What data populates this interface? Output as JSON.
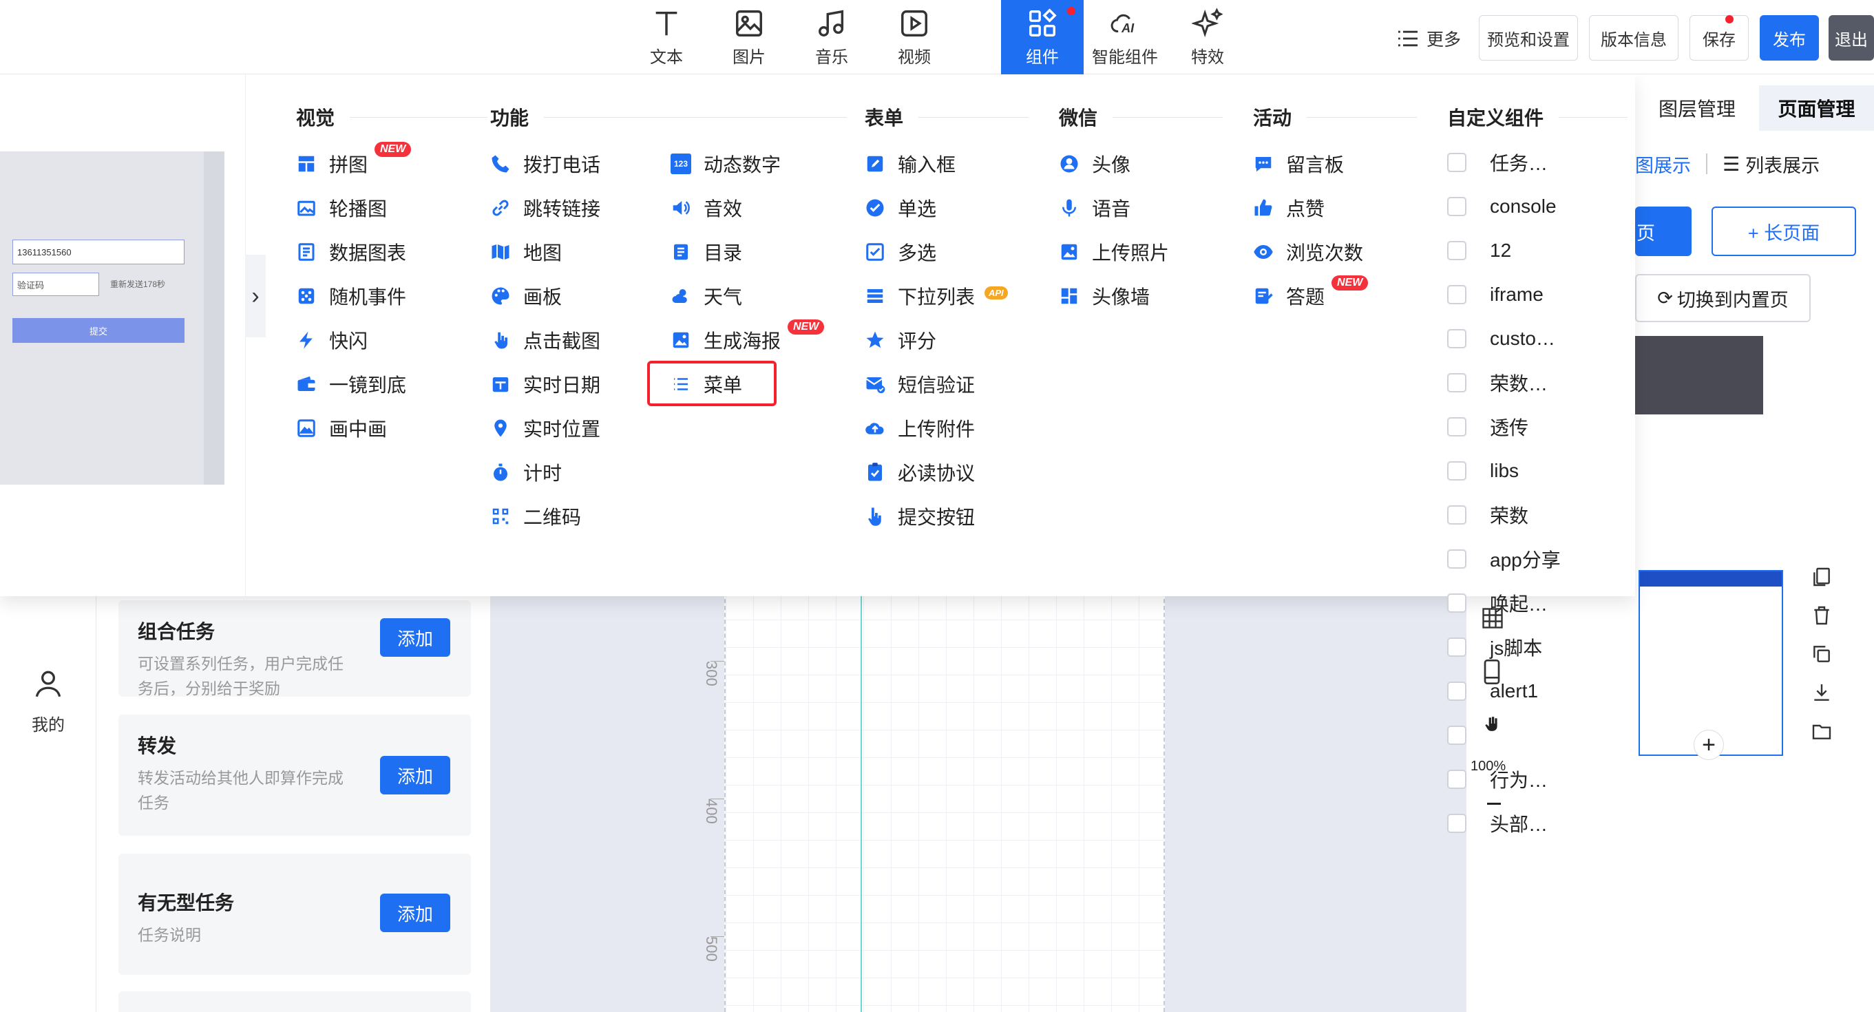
{
  "topbar": {
    "tools": [
      {
        "label": "文本",
        "icon": "text-icon"
      },
      {
        "label": "图片",
        "icon": "image-icon"
      },
      {
        "label": "音乐",
        "icon": "music-icon"
      },
      {
        "label": "视频",
        "icon": "video-icon"
      },
      {
        "label": "组件",
        "icon": "components-icon",
        "active": true
      },
      {
        "label": "智能组件",
        "icon": "ai-cloud-icon"
      },
      {
        "label": "特效",
        "icon": "sparkle-icon"
      }
    ],
    "more": "更多",
    "preview_settings": "预览和设置",
    "version_info": "版本信息",
    "save": "保存",
    "publish": "发布",
    "exit": "退出"
  },
  "preview": {
    "phone_value": "13611351560",
    "code_placeholder": "验证码",
    "resend": "重新发送178秒",
    "submit": "提交"
  },
  "columns": {
    "visual": {
      "title": "视觉",
      "items": [
        {
          "label": "拼图",
          "icon": "puzzle-icon",
          "badge": "NEW"
        },
        {
          "label": "轮播图",
          "icon": "carousel-icon"
        },
        {
          "label": "数据图表",
          "icon": "chart-icon"
        },
        {
          "label": "随机事件",
          "icon": "dice-icon"
        },
        {
          "label": "快闪",
          "icon": "lightning-icon"
        },
        {
          "label": "一镜到底",
          "icon": "wallet-icon"
        },
        {
          "label": "画中画",
          "icon": "picture-in-picture-icon"
        }
      ]
    },
    "function": {
      "title": "功能",
      "items_a": [
        {
          "label": "拨打电话",
          "icon": "phone-icon"
        },
        {
          "label": "跳转链接",
          "icon": "link-icon"
        },
        {
          "label": "地图",
          "icon": "map-icon"
        },
        {
          "label": "画板",
          "icon": "palette-icon"
        },
        {
          "label": "点击截图",
          "icon": "tap-icon"
        },
        {
          "label": "实时日期",
          "icon": "calendar-icon"
        },
        {
          "label": "实时位置",
          "icon": "location-icon"
        },
        {
          "label": "计时",
          "icon": "stopwatch-icon"
        },
        {
          "label": "二维码",
          "icon": "qrcode-icon"
        }
      ],
      "items_b": [
        {
          "label": "动态数字",
          "icon": "number-icon",
          "icon_text": "123"
        },
        {
          "label": "音效",
          "icon": "speaker-icon"
        },
        {
          "label": "目录",
          "icon": "catalog-icon"
        },
        {
          "label": "天气",
          "icon": "weather-icon"
        },
        {
          "label": "生成海报",
          "icon": "poster-icon",
          "badge": "NEW"
        },
        {
          "label": "菜单",
          "icon": "menu-list-icon"
        }
      ]
    },
    "form": {
      "title": "表单",
      "items": [
        {
          "label": "输入框",
          "icon": "edit-icon"
        },
        {
          "label": "单选",
          "icon": "radio-check-icon"
        },
        {
          "label": "多选",
          "icon": "checkbox-icon"
        },
        {
          "label": "下拉列表",
          "icon": "dropdown-list-icon",
          "badge": "API"
        },
        {
          "label": "评分",
          "icon": "star-icon"
        },
        {
          "label": "短信验证",
          "icon": "sms-icon"
        },
        {
          "label": "上传附件",
          "icon": "upload-cloud-icon"
        },
        {
          "label": "必读协议",
          "icon": "agreement-icon"
        },
        {
          "label": "提交按钮",
          "icon": "pointer-icon"
        }
      ]
    },
    "wechat": {
      "title": "微信",
      "items": [
        {
          "label": "头像",
          "icon": "user-circle-icon"
        },
        {
          "label": "语音",
          "icon": "microphone-icon"
        },
        {
          "label": "上传照片",
          "icon": "photo-icon"
        },
        {
          "label": "头像墙",
          "icon": "grid-icon"
        }
      ]
    },
    "activity": {
      "title": "活动",
      "items": [
        {
          "label": "留言板",
          "icon": "message-icon"
        },
        {
          "label": "点赞",
          "icon": "thumb-up-icon"
        },
        {
          "label": "浏览次数",
          "icon": "eye-icon"
        },
        {
          "label": "答题",
          "icon": "quiz-icon",
          "badge": "NEW"
        }
      ]
    },
    "custom": {
      "title": "自定义组件",
      "items": [
        "任务…",
        "console",
        "12",
        "iframe",
        "custo…",
        "荣数…",
        "透传",
        "libs",
        "荣数",
        "app分享",
        "唤起…",
        "js脚本",
        "alert1",
        "",
        "行为…",
        "头部…"
      ]
    }
  },
  "leftnav": {
    "mine": "我的"
  },
  "tasks": [
    {
      "title": "组合任务",
      "desc": "可设置系列任务，用户完成任务后，分别给于奖励",
      "add": "添加"
    },
    {
      "title": "转发",
      "desc": "转发活动给其他人即算作完成任务",
      "add": "添加"
    },
    {
      "title": "有无型任务",
      "desc": "任务说明",
      "add": "添加"
    }
  ],
  "ruler": {
    "marks": [
      "300",
      "400",
      "500"
    ]
  },
  "zoom": "100%",
  "rightpanel": {
    "tab_layers": "图层管理",
    "tab_pages": "页面管理",
    "view_graph": "图展示",
    "view_list": "列表展示",
    "page_btn": "页",
    "long_page_btn": "+ 长页面",
    "switch_inner": "切换到内置页"
  },
  "colors": {
    "accent": "#1e6ff1",
    "danger": "#f5222d"
  }
}
